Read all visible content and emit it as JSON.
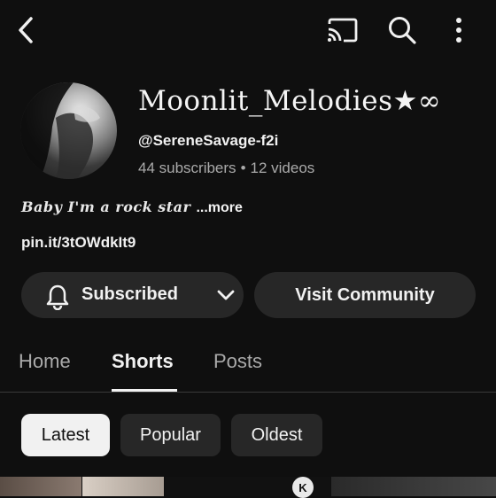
{
  "header": {
    "back_icon": "back-arrow-icon",
    "cast_icon": "cast-icon",
    "search_icon": "search-icon",
    "more_icon": "more-vert-icon"
  },
  "channel": {
    "name": "Moonlit_Melodies★∞",
    "handle": "@SereneSavage-f2i",
    "subscribers": "44 subscribers",
    "separator": "•",
    "videos": "12 videos",
    "bio": "Baby I'm a rock star",
    "bio_more": "...more",
    "link": "pin.it/3tOWdkIt9"
  },
  "actions": {
    "subscribed_label": "Subscribed",
    "visit_label": "Visit Community"
  },
  "tabs": [
    {
      "label": "Home"
    },
    {
      "label": "Shorts"
    },
    {
      "label": "Posts"
    }
  ],
  "active_tab": "Shorts",
  "filters": [
    {
      "label": "Latest"
    },
    {
      "label": "Popular"
    },
    {
      "label": "Oldest"
    }
  ],
  "active_filter": "Latest",
  "thumb_badge": "K",
  "colors": {
    "background": "#0f0f0f",
    "surface": "#272727",
    "text": "#f1f1f1",
    "muted": "#aaaaaa"
  }
}
